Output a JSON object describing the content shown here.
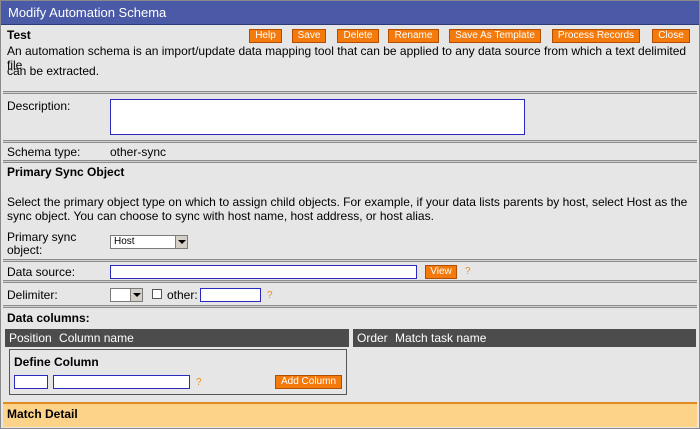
{
  "window": {
    "title": "Modify Automation Schema"
  },
  "header": {
    "name": "Test",
    "buttons": {
      "help": "Help",
      "save": "Save",
      "delete": "Delete",
      "rename": "Rename",
      "save_as_template": "Save As Template",
      "process_records": "Process Records",
      "close": "Close"
    },
    "intro_line1": "An automation schema is an import/update data mapping tool that can be applied to any data source from which a text delimited file",
    "intro_line2": "can be extracted."
  },
  "description": {
    "label": "Description:",
    "value": ""
  },
  "schema_type": {
    "label": "Schema type:",
    "value": "other-sync"
  },
  "primary_sync": {
    "heading": "Primary Sync Object",
    "help_line1": "Select the primary object type on which to assign child objects. For example, if your data lists parents by host, select Host as the",
    "help_line2": "sync object. You can choose to sync with host name, host address, or host alias.",
    "label_line1": "Primary sync",
    "label_line2": "object:",
    "selected": "Host"
  },
  "data_source": {
    "label": "Data source:",
    "value": "",
    "view_button": "View",
    "help_mark": "?"
  },
  "delimiter": {
    "label": "Delimiter:",
    "selected": "",
    "other_label": "other:",
    "other_value": "",
    "help_mark": "?"
  },
  "data_columns": {
    "heading": "Data columns:",
    "left_headers": [
      "Position",
      "Column name"
    ],
    "right_headers": [
      "Order",
      "Match task name"
    ],
    "define": {
      "heading": "Define Column",
      "position_value": "",
      "name_value": "",
      "help_mark": "?",
      "add_button": "Add Column"
    }
  },
  "match_detail": {
    "heading": "Match Detail"
  },
  "colors": {
    "title_bar": "#4a5aa6",
    "button": "#f57a0c",
    "panel": "#e6e6e6",
    "dark_header": "#4c4c4c",
    "match_bar": "#fdd38a",
    "input_border": "#2a2ac0"
  }
}
